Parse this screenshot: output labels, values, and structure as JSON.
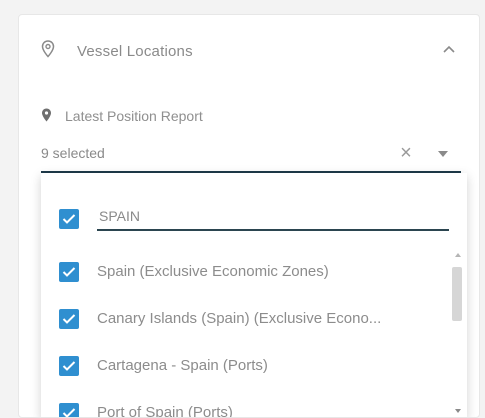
{
  "panel": {
    "title": "Vessel Locations",
    "icon": "map-pin-outline-icon",
    "toggle_icon": "chevron-up-icon"
  },
  "field": {
    "label": "Latest Position Report",
    "label_icon": "map-pin-icon",
    "value": "9 selected",
    "clear_glyph": "×"
  },
  "dropdown": {
    "search_value": "SPAIN",
    "options": [
      {
        "label": "Spain (Exclusive Economic Zones)",
        "checked": true
      },
      {
        "label": "Canary Islands (Spain) (Exclusive Econo...",
        "checked": true
      },
      {
        "label": "Cartagena - Spain (Ports)",
        "checked": true
      },
      {
        "label": "Port of Spain (Ports)",
        "checked": true
      }
    ]
  },
  "colors": {
    "accent": "#2f8fd0",
    "underline": "#1e3a4a"
  }
}
